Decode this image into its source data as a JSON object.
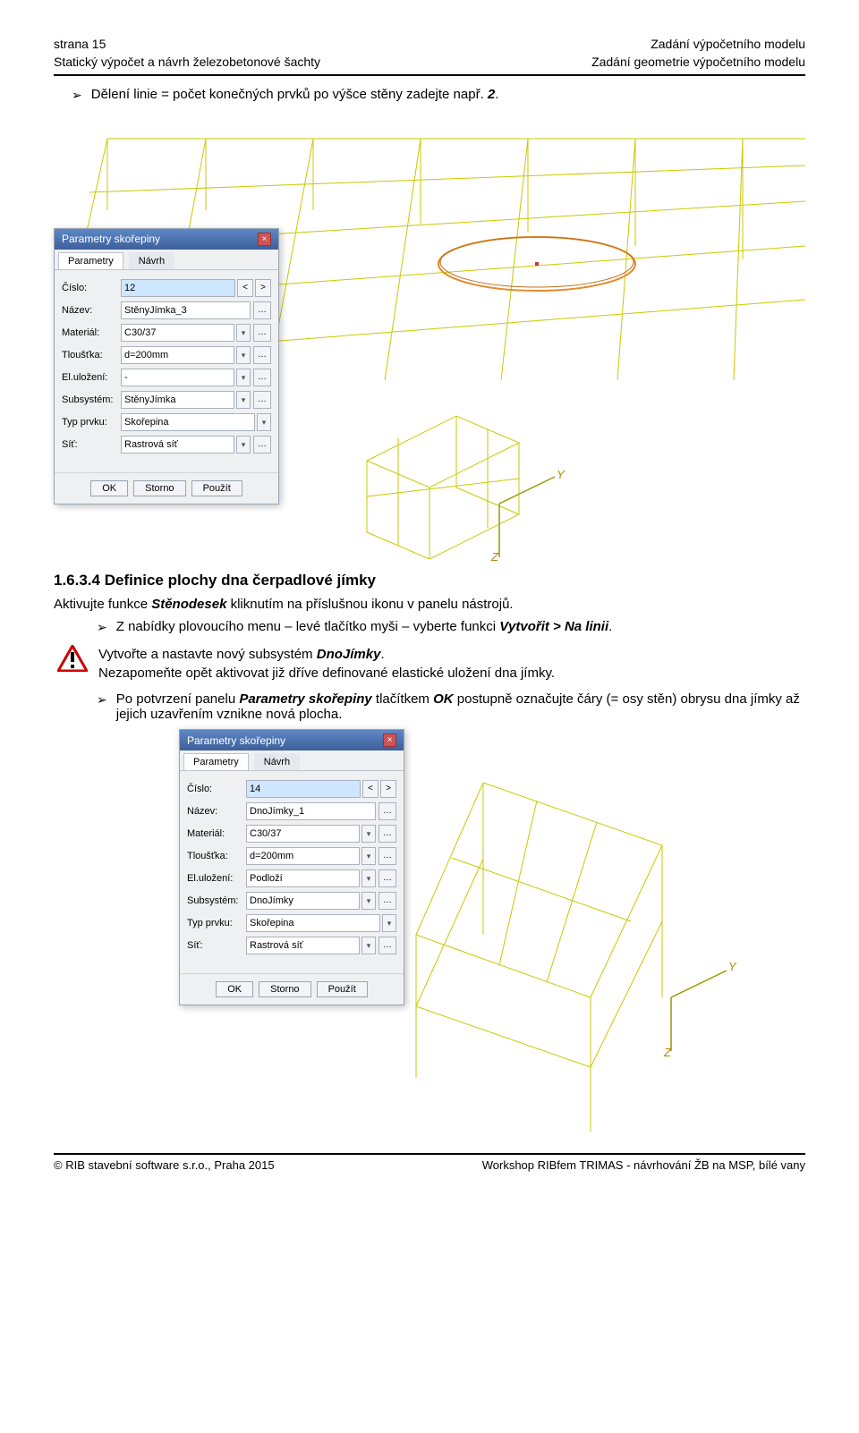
{
  "header": {
    "left_line1": "strana 15",
    "left_line2": "Statický výpočet a návrh železobetonové šachty",
    "right_line1": "Zadání výpočetního modelu",
    "right_line2": "Zadání geometrie výpočetního modelu"
  },
  "para1": "Dělení linie = počet konečných prvků po výšce stěny zadejte např. ",
  "para1_val": "2",
  "dialog1": {
    "title": "Parametry skořepiny",
    "tabs": [
      "Parametry",
      "Návrh"
    ],
    "fields": {
      "cislo_lbl": "Číslo:",
      "cislo": "12",
      "nazev_lbl": "Název:",
      "nazev": "StěnyJímka_3",
      "material_lbl": "Materiál:",
      "material": "C30/37",
      "tloustka_lbl": "Tloušťka:",
      "tloustka": "d=200mm",
      "ulozeni_lbl": "El.uložení:",
      "ulozeni": "-",
      "subsystem_lbl": "Subsystém:",
      "subsystem": "StěnyJímka",
      "typ_lbl": "Typ prvku:",
      "typ": "Skořepina",
      "sit_lbl": "Síť:",
      "sit": "Rastrová síť"
    },
    "buttons": {
      "ok": "OK",
      "storno": "Storno",
      "pouzit": "Použít"
    }
  },
  "section": {
    "num": "1.6.3.4 ",
    "title": "Definice plochy dna čerpadlové jímky"
  },
  "para2_a": "Aktivujte funkce ",
  "para2_b": "Stěnodesek",
  "para2_c": " kliknutím na příslušnou ikonu v panelu nástrojů.",
  "bullet2_a": "Z nabídky plovoucího menu – levé tlačítko myši – vyberte funkci ",
  "bullet2_b": "Vytvořit > Na linii",
  "bullet2_c": ".",
  "warn_line1_a": "Vytvořte a nastavte nový subsystém ",
  "warn_line1_b": "DnoJímky",
  "warn_line1_c": ".",
  "warn_line2": "Nezapomeňte opět aktivovat již dříve definované elastické uložení dna jímky.",
  "bullet3_a": "Po potvrzení panelu ",
  "bullet3_b": "Parametry skořepiny",
  "bullet3_c": " tlačítkem ",
  "bullet3_d": "OK",
  "bullet3_e": " postupně označujte čáry (= osy stěn) obrysu dna jímky až jejich uzavřením vznikne nová plocha.",
  "dialog2": {
    "title": "Parametry skořepiny",
    "tabs": [
      "Parametry",
      "Návrh"
    ],
    "fields": {
      "cislo_lbl": "Číslo:",
      "cislo": "14",
      "nazev_lbl": "Název:",
      "nazev": "DnoJímky_1",
      "material_lbl": "Materiál:",
      "material": "C30/37",
      "tloustka_lbl": "Tloušťka:",
      "tloustka": "d=200mm",
      "ulozeni_lbl": "El.uložení:",
      "ulozeni": "Podloží",
      "subsystem_lbl": "Subsystém:",
      "subsystem": "DnoJímky",
      "typ_lbl": "Typ prvku:",
      "typ": "Skořepina",
      "sit_lbl": "Síť:",
      "sit": "Rastrová síť"
    },
    "buttons": {
      "ok": "OK",
      "storno": "Storno",
      "pouzit": "Použít"
    }
  },
  "axes": {
    "y": "Y",
    "z": "Z"
  },
  "footer": {
    "left": "© RIB stavební software s.r.o., Praha 2015",
    "right": "Workshop RIBfem TRIMAS - návrhování ŽB na MSP, bílé vany"
  }
}
